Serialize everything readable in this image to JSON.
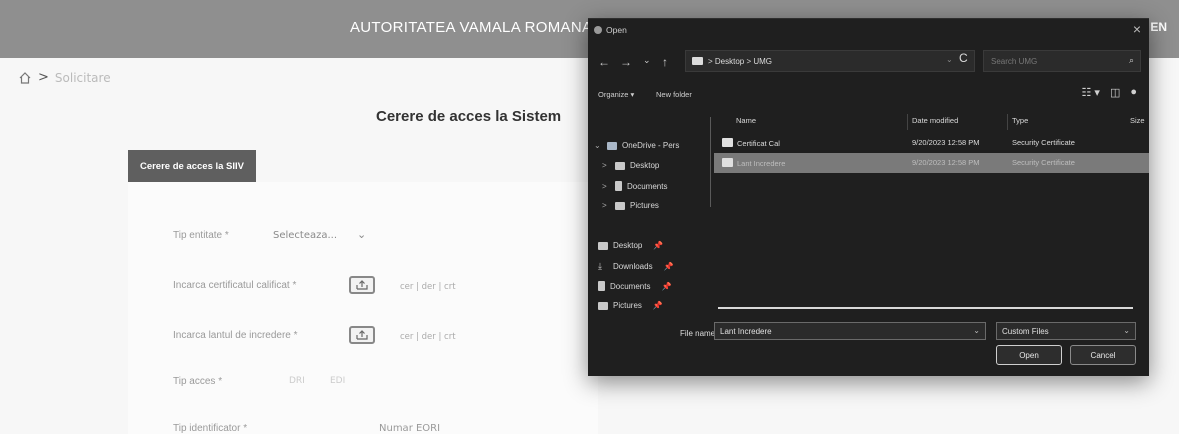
{
  "header": {
    "title": "AUTORITATEA VAMALA ROMANA",
    "lang": "EN"
  },
  "breadcrumb": {
    "home_icon": "home-icon",
    "separator": ">",
    "current": "Solicitare"
  },
  "page": {
    "title": "Cerere de acces la Sistem"
  },
  "section": {
    "tab_label": "Cerere de acces la SIIV"
  },
  "form": {
    "tip_entitate": {
      "label": "Tip entitate *",
      "value": "Selecteaza...",
      "chevron": "⌄"
    },
    "certificat": {
      "label": "Incarca certificatul calificat *",
      "hint": "cer | der | crt"
    },
    "certificat_incredere": {
      "label": "Incarca lantul de incredere *",
      "hint": "cer | der | crt"
    },
    "tip_acces": {
      "label": "Tip acces *",
      "options": [
        "DRI",
        "EDI"
      ]
    },
    "tip_identificator": {
      "label": "Tip identificator *",
      "value": "Numar EORI",
      "chevron": "⌄"
    }
  },
  "dialog": {
    "title": "Open",
    "close": "×",
    "nav": {
      "back": "←",
      "forward": "→",
      "recent": "⌄",
      "up": "↑"
    },
    "address": {
      "parts": "> Desktop > UMG",
      "dropdown": "⌄",
      "refresh": "C"
    },
    "search_placeholder": "Search UMG",
    "commands": {
      "organize": "Organize ▾",
      "new_folder": "New folder"
    },
    "view_icons": [
      "☷ ▾",
      "◫",
      "●"
    ],
    "tree": [
      {
        "label": "OneDrive - Pers",
        "chevron": "⌄"
      },
      {
        "label": "Desktop",
        "chevron": ">"
      },
      {
        "label": "Documents",
        "chevron": ">"
      },
      {
        "label": "Pictures",
        "chevron": ">"
      }
    ],
    "quick_access": [
      {
        "label": "Desktop",
        "pin": "📌"
      },
      {
        "label": "Downloads",
        "pin": "📌"
      },
      {
        "label": "Documents",
        "pin": "📌"
      },
      {
        "label": "Pictures",
        "pin": "📌"
      }
    ],
    "columns": {
      "name": "Name",
      "date": "Date modified",
      "type": "Type",
      "size": "Size"
    },
    "files": [
      {
        "name": "Certificat Cal",
        "date": "9/20/2023 12:58 PM",
        "type": "Security Certificate",
        "selected": false
      },
      {
        "name": "Lant Incredere",
        "date": "9/20/2023 12:58 PM",
        "type": "Security Certificate",
        "selected": true
      }
    ],
    "filename_label": "File name:",
    "filename_value": "Lant Incredere",
    "filetype_value": "Custom Files",
    "open_label": "Open",
    "cancel_label": "Cancel"
  }
}
